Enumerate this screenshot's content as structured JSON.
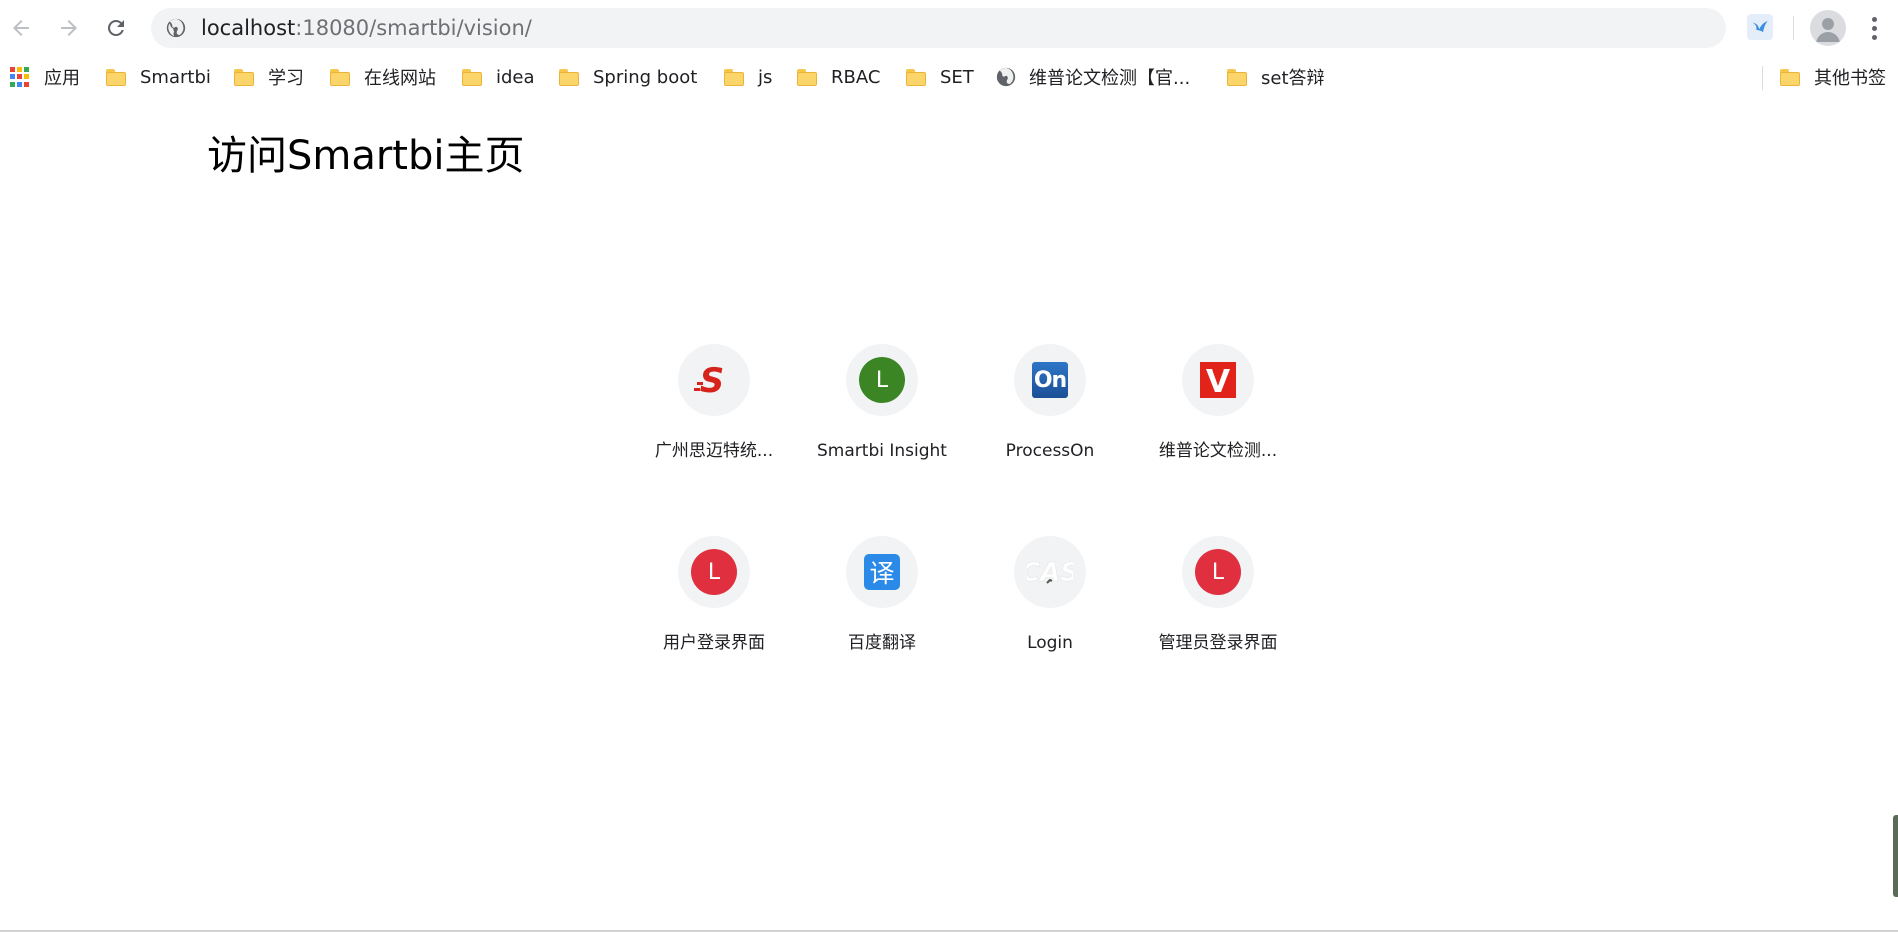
{
  "browser": {
    "url_host": "localhost",
    "url_path": ":18080/smartbi/vision/"
  },
  "bookmarks": {
    "apps_label": "应用",
    "items": [
      {
        "label": "Smartbi",
        "icon": "folder-icon"
      },
      {
        "label": "学习",
        "icon": "folder-icon"
      },
      {
        "label": "在线网站",
        "icon": "folder-icon"
      },
      {
        "label": "idea",
        "icon": "folder-icon"
      },
      {
        "label": "Spring boot",
        "icon": "folder-icon"
      },
      {
        "label": "js",
        "icon": "folder-icon"
      },
      {
        "label": "RBAC",
        "icon": "folder-icon"
      },
      {
        "label": "SET",
        "icon": "folder-icon"
      },
      {
        "label": "维普论文检测【官...",
        "icon": "globe-icon"
      },
      {
        "label": "set答辩",
        "icon": "folder-icon"
      }
    ],
    "other_label": "其他书签"
  },
  "page": {
    "title": "访问Smartbi主页"
  },
  "shortcuts": [
    {
      "label": "广州思迈特统...",
      "icon": "smartbi-logo-icon",
      "glyph": "S",
      "color": "#d6231c"
    },
    {
      "label": "Smartbi Insight",
      "icon": "letter-l-icon",
      "glyph": "L",
      "color": "#3b8524"
    },
    {
      "label": "ProcessOn",
      "icon": "processon-logo-icon",
      "glyph": "On",
      "color": "#1f5ca8"
    },
    {
      "label": "维普论文检测...",
      "icon": "vip-logo-icon",
      "glyph": "V",
      "color": "#e2231a"
    },
    {
      "label": "用户登录界面",
      "icon": "letter-l-icon",
      "glyph": "L",
      "color": "#e03040"
    },
    {
      "label": "百度翻译",
      "icon": "baidu-translate-icon",
      "glyph": "译",
      "color": "#2b8ae8"
    },
    {
      "label": "Login",
      "icon": "cas-logo-icon",
      "glyph": "CAS",
      "color": "#ffffff"
    },
    {
      "label": "管理员登录界面",
      "icon": "letter-l-icon",
      "glyph": "L",
      "color": "#e03040"
    }
  ]
}
